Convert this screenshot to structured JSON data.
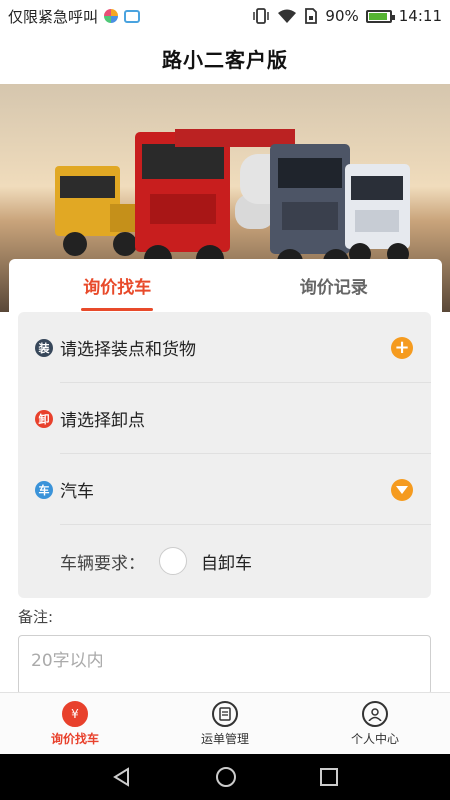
{
  "status_bar": {
    "carrier": "仅限紧急呼叫",
    "battery": "90%",
    "time": "14:11",
    "icons": [
      "colorful-dot-icon",
      "image-notification-icon",
      "vibrate-icon",
      "wifi-icon",
      "sim-icon",
      "battery-icon"
    ]
  },
  "app": {
    "title": "路小二客户版"
  },
  "banner": {
    "icon": "truck-banner-image"
  },
  "tabs": [
    {
      "label": "询价找车",
      "active": true
    },
    {
      "label": "询价记录",
      "active": false
    }
  ],
  "form": {
    "loading": {
      "badge": "装",
      "label": "请选择装点和货物",
      "action_icon": "plus-circle-icon"
    },
    "unloading": {
      "badge": "卸",
      "label": "请选择卸点"
    },
    "vehicle": {
      "badge": "车",
      "label": "汽车",
      "action_icon": "chevron-down-circle-icon"
    },
    "vehicle_requirement": {
      "label": "车辆要求：",
      "option": "自卸车"
    },
    "remark": {
      "label": "备注:",
      "placeholder": "20字以内"
    }
  },
  "bottom_nav": [
    {
      "label": "询价找车",
      "icon": "yen-icon",
      "active": true
    },
    {
      "label": "运单管理",
      "icon": "document-icon",
      "active": false
    },
    {
      "label": "个人中心",
      "icon": "person-icon",
      "active": false
    }
  ],
  "system_nav": [
    "back-icon",
    "home-icon",
    "recents-icon"
  ],
  "colors": {
    "accent": "#e84a2a",
    "orange": "#f59b1f",
    "badge_dark": "#37475a",
    "badge_red": "#e8412c",
    "badge_blue": "#3a93d9"
  }
}
